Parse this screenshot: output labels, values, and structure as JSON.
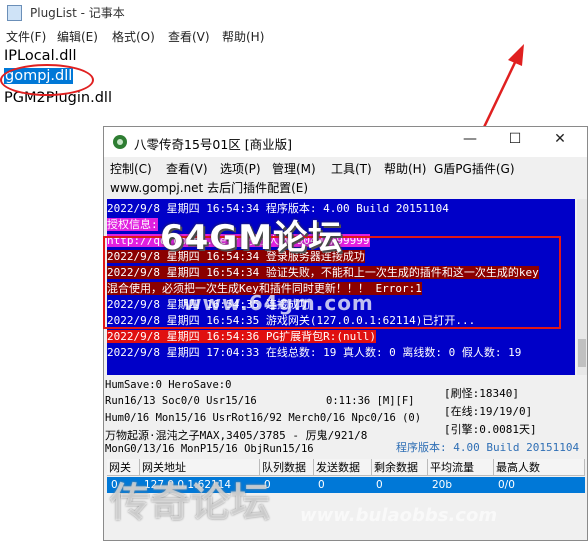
{
  "notepad": {
    "title": "PlugList - 记事本",
    "menu": [
      "文件(F)",
      "编辑(E)",
      "格式(O)",
      "查看(V)",
      "帮助(H)"
    ],
    "lines": [
      "IPLocal.dll",
      "gompj.dll",
      "PGM2Plugin.dll"
    ]
  },
  "game_window": {
    "title": "八零传奇15号01区 [商业版]",
    "controls": [
      "—",
      "☐",
      "✕"
    ],
    "menu": [
      "控制(C)",
      "查看(V)",
      "选项(P)",
      "管理(M)",
      "工具(T)",
      "帮助(H)",
      "G盾PG插件(G)"
    ],
    "subtitle": "www.gompj.net 去后门插件配置(E)",
    "log": [
      {
        "text": "2022/9/8 星期四 16:54:34 程序版本: 4.00 Build 20151104",
        "bg": "#0000c8",
        "fg": "#ffffff"
      },
      {
        "text": "授权信息:",
        "bg": "#e020e0",
        "fg": "#ffffff"
      },
      {
        "text": "http://qq.gompj.net/ 授权人数:90404/99999",
        "bg": "#e020e0",
        "fg": "#ffffff"
      },
      {
        "text": "2022/9/8 星期四 16:54:34 登录服务器连接成功",
        "bg": "#8b0000",
        "fg": "#ffffff"
      },
      {
        "text": "2022/9/8 星期四 16:54:34 验证失败，不能和上一次生成的插件和这一次生成的key",
        "bg": "#8b0000",
        "fg": "#ffffff"
      },
      {
        "text": "混合使用，必须把一次生成Key和插件同时更新！！！ Error:1",
        "bg": "#8b0000",
        "fg": "#ffffff"
      },
      {
        "text": "2022/9/8 星期四 16:54:35 连接成功",
        "bg": "#0000c8",
        "fg": "#ffffff"
      },
      {
        "text": "2022/9/8 星期四 16:54:35 游戏网关(127.0.0.1:62114)已打开...",
        "bg": "#0000c8",
        "fg": "#ffffff"
      },
      {
        "text": "2022/9/8 星期四 16:54:36 PG扩展背包R:(null)",
        "bg": "#e01010",
        "fg": "#ffffff"
      },
      {
        "text": "2022/9/8 星期四 17:04:33 在线总数: 19 真人数: 0 离线数: 0 假人数: 19",
        "bg": "#0000c8",
        "fg": "#ffffff"
      }
    ],
    "stats": [
      "HumSave:0 HeroSave:0",
      "Run16/13 Soc0/0 Usr15/16",
      "Hum0/16 Mon15/16 UsrRot16/92 Merch0/16 Npc0/16 (0)",
      "万物起源·混沌之子MAX,3405/3785 - 厉鬼/921/8",
      "MonG0/13/16 MonP15/16 ObjRun15/16"
    ],
    "time": "0:11:36 [M][F]",
    "right_stats": [
      "[刷怪:18340]",
      "[在线:19/19/0]",
      "[引擎:0.0081天]"
    ],
    "version": "程序版本: 4.00 Build 20151104",
    "table": {
      "headers": [
        "网关",
        "网关地址",
        "队列数据",
        "发送数据",
        "剩余数据",
        "平均流量",
        "最高人数"
      ],
      "rows": [
        [
          "0",
          "127.0.0.1:62114",
          "0",
          "0",
          "0",
          "20b",
          "0/0"
        ]
      ]
    }
  },
  "watermark": {
    "main": "64GM论坛",
    "sub": "www.64gm.com",
    "bottom": "传奇论坛",
    "url": "www.bulaobbs.com"
  },
  "colors": {
    "selection": "#0078d7",
    "log_bg": "#0000c8",
    "alert": "#e01818"
  }
}
